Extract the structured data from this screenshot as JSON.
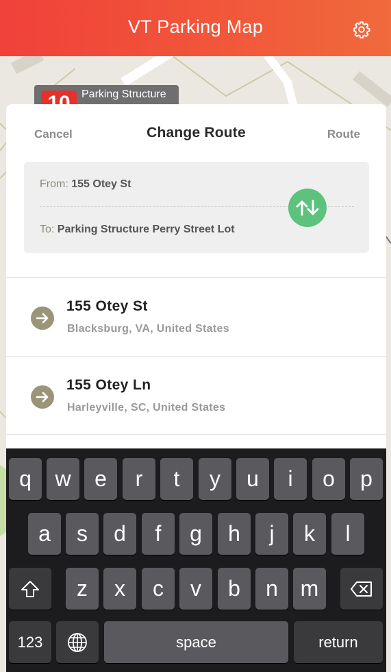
{
  "header": {
    "title": "VT Parking Map",
    "settings_icon": "gear-icon"
  },
  "map_marker": {
    "number": "10",
    "label": "Parking Structure"
  },
  "route_card": {
    "cancel_label": "Cancel",
    "title": "Change Route",
    "route_label": "Route",
    "from_prefix": "From:",
    "from_value": "155 Otey St",
    "to_prefix": "To:",
    "to_value": "Parking Structure Perry Street Lot",
    "swap_icon": "swap-arrows-icon",
    "swap_color": "#5cc27c"
  },
  "results": [
    {
      "name": "155 Otey St",
      "subtitle": "Blacksburg, VA, United States"
    },
    {
      "name": "155 Otey Ln",
      "subtitle": "Harleyville, SC, United States"
    }
  ],
  "keyboard": {
    "row1": [
      "q",
      "w",
      "e",
      "r",
      "t",
      "y",
      "u",
      "i",
      "o",
      "p"
    ],
    "row2": [
      "a",
      "s",
      "d",
      "f",
      "g",
      "h",
      "j",
      "k",
      "l"
    ],
    "row3": [
      "z",
      "x",
      "c",
      "v",
      "b",
      "n",
      "m"
    ],
    "numbers_label": "123",
    "space_label": "space",
    "return_label": "return"
  },
  "colors": {
    "header_start": "#f0413a",
    "header_end": "#f06a3c",
    "accent_green": "#5cc27c",
    "result_icon": "#9a9579"
  }
}
